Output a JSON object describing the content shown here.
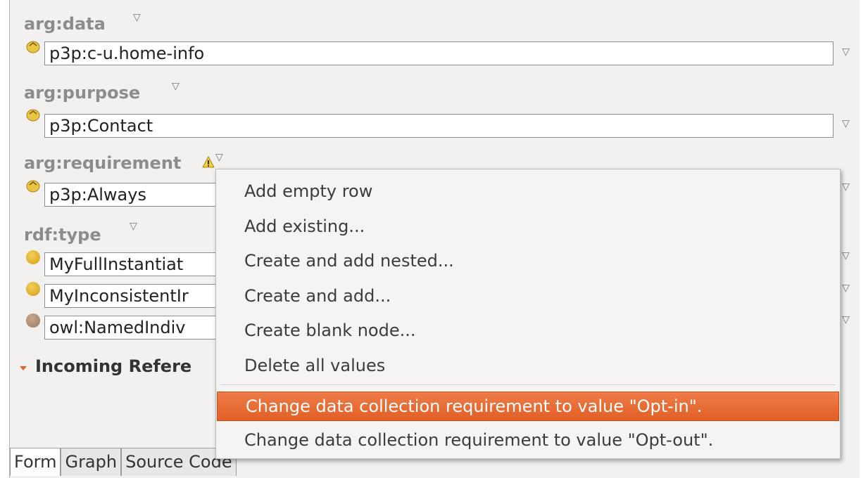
{
  "properties": [
    {
      "label": "arg:data",
      "value": "p3p:c-u.home-info"
    },
    {
      "label": "arg:purpose",
      "value": "p3p:Contact"
    },
    {
      "label": "arg:requirement",
      "value": "p3p:Always"
    }
  ],
  "rdf_type": {
    "label": "rdf:type",
    "values": [
      "MyFullInstantiat",
      "MyInconsistentIr",
      "owl:NamedIndiv"
    ]
  },
  "incoming": {
    "title": "Incoming Refere"
  },
  "tabs": [
    "Form",
    "Graph",
    "Source Code"
  ],
  "context_menu": {
    "items": [
      "Add empty row",
      "Add existing...",
      "Create and add nested...",
      "Create and add...",
      "Create blank node...",
      "Delete all values"
    ],
    "actions": [
      "Change data collection requirement to value \"Opt-in\".",
      "Change data collection requirement to value \"Opt-out\"."
    ],
    "highlighted_index": 0
  },
  "colors": {
    "highlight": "#e76a32",
    "individual_dot": "#e0ae22",
    "named_individual_dot": "#b0927a"
  }
}
